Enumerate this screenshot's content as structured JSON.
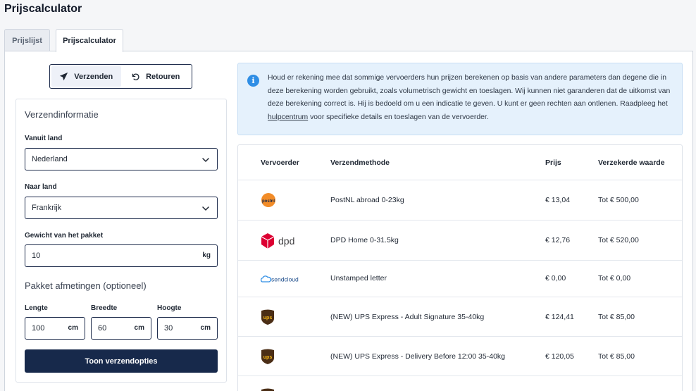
{
  "page": {
    "title": "Prijscalculator"
  },
  "tabs": [
    {
      "label": "Prijslijst",
      "active": false
    },
    {
      "label": "Prijscalculator",
      "active": true
    }
  ],
  "mode_toggle": {
    "send_label": "Verzenden",
    "return_label": "Retouren",
    "selected": "Verzenden"
  },
  "form": {
    "section_title": "Verzendinformatie",
    "from_label": "Vanuit land",
    "from_value": "Nederland",
    "to_label": "Naar land",
    "to_value": "Frankrijk",
    "weight_label": "Gewicht van het pakket",
    "weight_value": "10",
    "weight_unit": "kg",
    "dimensions_title": "Pakket afmetingen (optioneel)",
    "length_label": "Lengte",
    "length_value": "100",
    "width_label": "Breedte",
    "width_value": "60",
    "height_label": "Hoogte",
    "height_value": "30",
    "dim_unit": "cm",
    "submit_label": "Toon verzendopties"
  },
  "info": {
    "text_before_link": "Houd er rekening mee dat sommige vervoerders hun prijzen berekenen op basis van andere parameters dan degene die in deze berekening worden gebruikt, zoals volumetrisch gewicht en toeslagen. Wij kunnen niet garanderen dat de uitkomst van deze berekening correct is. Hij is bedoeld om u een indicatie te geven. U kunt er geen rechten aan ontlenen. Raadpleeg het ",
    "link_text": "hulpcentrum",
    "text_after_link": " voor specifieke details en toeslagen van de vervoerder.",
    "icon": "info-icon",
    "color": "#2f8ee5"
  },
  "table": {
    "headers": {
      "carrier": "Vervoerder",
      "method": "Verzendmethode",
      "price": "Prijs",
      "insured": "Verzekerde waarde"
    },
    "rows": [
      {
        "carrier": "postnl",
        "logo_text": "postnl",
        "method": "PostNL abroad 0-23kg",
        "price": "€ 13,04",
        "insured": "Tot € 500,00"
      },
      {
        "carrier": "dpd",
        "logo_text": "dpd",
        "method": "DPD Home 0-31.5kg",
        "price": "€ 12,76",
        "insured": "Tot € 520,00"
      },
      {
        "carrier": "sendcloud",
        "logo_text": "sendcloud",
        "method": "Unstamped letter",
        "price": "€ 0,00",
        "insured": "Tot € 0,00"
      },
      {
        "carrier": "ups",
        "logo_text": "ups",
        "method": "(NEW) UPS Express - Adult Signature 35-40kg",
        "price": "€ 124,41",
        "insured": "Tot € 85,00"
      },
      {
        "carrier": "ups",
        "logo_text": "ups",
        "method": "(NEW) UPS Express - Delivery Before 12:00 35-40kg",
        "price": "€ 120,05",
        "insured": "Tot € 85,00"
      }
    ]
  },
  "colors": {
    "primary_dark": "#17294b",
    "postnl": "#f28c28",
    "dpd": "#dc0032",
    "ups_brown": "#4b2e16",
    "ups_gold": "#f6b716",
    "sendcloud": "#2f8ee5"
  }
}
